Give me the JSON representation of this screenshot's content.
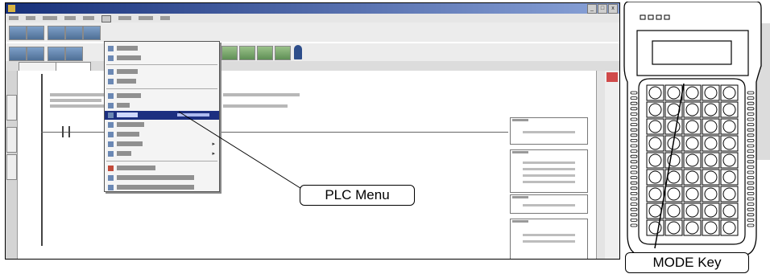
{
  "callouts": {
    "plc_menu": "PLC Menu",
    "mode_key": "MODE Key"
  },
  "window": {
    "window_buttons": [
      "_",
      "□",
      "x"
    ]
  },
  "menu": {
    "submenu_arrow": "▸"
  },
  "colors": {
    "title_bar": "#17307a",
    "menu_highlight": "#1c2f80",
    "device_body": "#ffffff",
    "outline": "#000000"
  }
}
